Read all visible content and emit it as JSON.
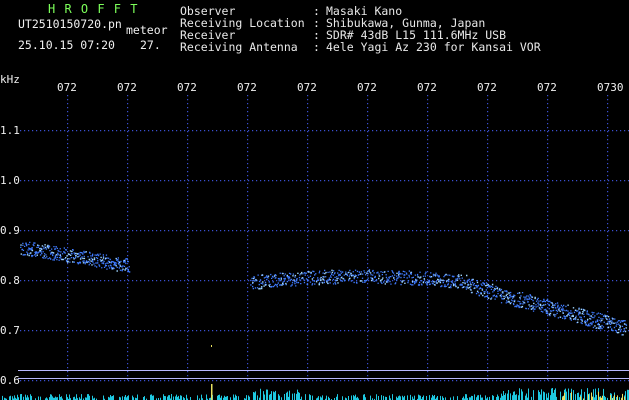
{
  "header": {
    "title": "H R O F F T",
    "filename": "UT2510150720.pn",
    "mode": "meteor",
    "datetime": "25.10.15 07:20",
    "extra": "27.",
    "fields": [
      {
        "label": "Observer",
        "sep": ":",
        "value": "Masaki Kano"
      },
      {
        "label": "Receiving Location",
        "sep": ":",
        "value": "Shibukawa, Gunma, Japan"
      },
      {
        "label": "Receiver",
        "sep": ":",
        "value": "SDR# 43dB L15 111.6MHz USB"
      },
      {
        "label": "Receiving Antenna",
        "sep": ":",
        "value": "4ele Yagi Az 230 for Kansai VOR"
      }
    ]
  },
  "axes": {
    "y_unit": "kHz",
    "y_ticks": [
      "1.1",
      "1.0",
      "0.9",
      "0.8",
      "0.7",
      "0.6"
    ],
    "y_tick_values": [
      1.1,
      1.0,
      0.9,
      0.8,
      0.7,
      0.6
    ],
    "x_ticks": [
      "072",
      "072",
      "072",
      "072",
      "072",
      "072",
      "072",
      "072",
      "072",
      "0730"
    ],
    "x_tick_values": [
      1,
      2,
      3,
      4,
      5,
      6,
      7,
      8,
      9,
      10
    ]
  },
  "colors": {
    "background": "#000000",
    "grid_dot": "#3a4fd0",
    "signal": "#3f7bff",
    "signal_bright": "#9fd6ff",
    "baseline": "#b8b8ff",
    "green_text": "#7cff5a",
    "bottom_noise": "#1ec8e0",
    "bottom_noise_hot": "#e8e060"
  }
}
